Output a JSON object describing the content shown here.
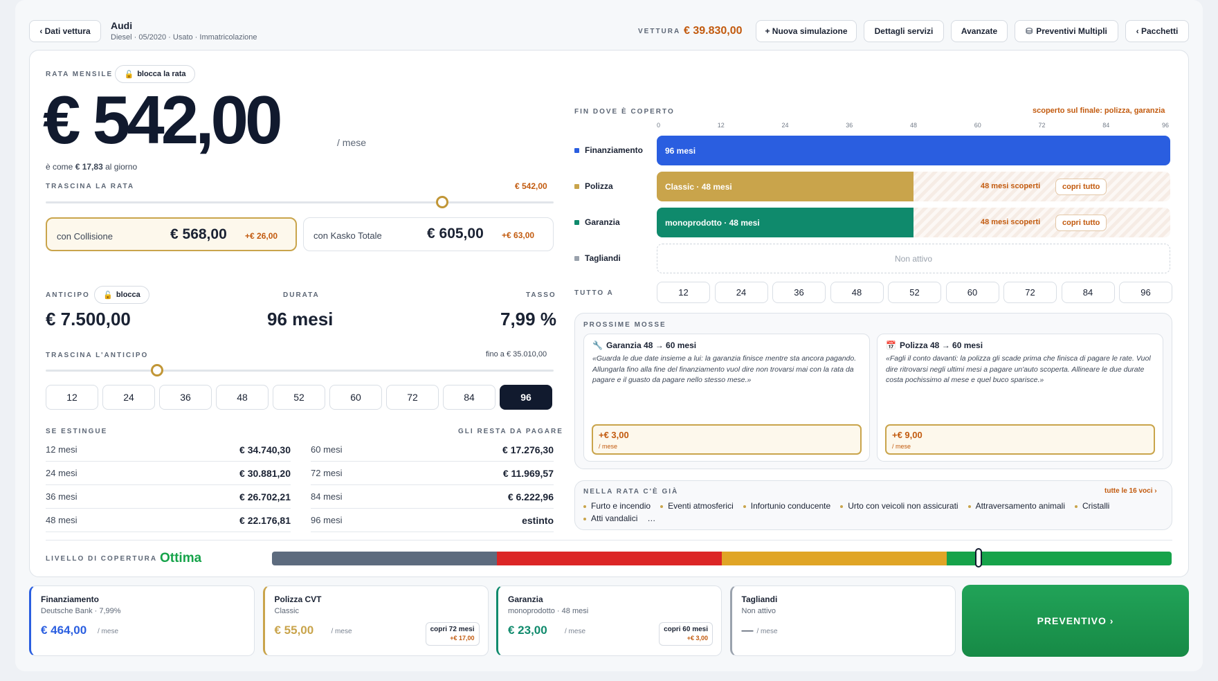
{
  "header": {
    "back_label": "‹ Dati vettura",
    "car_title": "Audi",
    "car_meta": "Diesel · 05/2020 · Usato · Immatricolazione",
    "vettura_label": "VETTURA",
    "vettura_price": "€ 39.830,00",
    "buttons": [
      "+ Nuova simulazione",
      "Dettagli servizi",
      "Avanzate",
      "Preventivi Multipli",
      "‹ Pacchetti"
    ]
  },
  "rata": {
    "label": "RATA MENSILE",
    "lock_label": "blocca la rata",
    "amount": "€ 542,00",
    "per_month": "/ mese",
    "per_day_prefix": "è come",
    "per_day_value": "€ 17,83",
    "per_day_suffix": "al giorno",
    "drag_label": "TRASCINA LA RATA",
    "drag_value": "€ 542,00",
    "slider_fraction": 0.78
  },
  "options": [
    {
      "label": "con Collisione",
      "price": "€ 568,00",
      "delta": "+€ 26,00"
    },
    {
      "label": "con Kasko Totale",
      "price": "€ 605,00",
      "delta": "+€ 63,00"
    }
  ],
  "anticipo": {
    "label": "ANTICIPO",
    "lock_label": "blocca",
    "value": "€ 7.500,00",
    "duration_label": "DURATA",
    "duration_value": "96 mesi",
    "rate_label": "TASSO",
    "rate_value": "7,99 %",
    "drag_label": "TRASCINA L'ANTICIPO",
    "max_label": "fino a € 35.010,00",
    "slider_fraction": 0.22
  },
  "months": [
    "12",
    "24",
    "36",
    "48",
    "52",
    "60",
    "72",
    "84",
    "96"
  ],
  "selected_month": "96",
  "payoff": {
    "left_header": "SE ESTINGUE",
    "right_header": "GLI RESTA DA PAGARE",
    "rows": [
      {
        "m1": "12 mesi",
        "v1": "€ 34.740,30",
        "m2": "60 mesi",
        "v2": "€ 17.276,30"
      },
      {
        "m1": "24 mesi",
        "v1": "€ 30.881,20",
        "m2": "72 mesi",
        "v2": "€ 11.969,57"
      },
      {
        "m1": "36 mesi",
        "v1": "€ 26.702,21",
        "m2": "84 mesi",
        "v2": "€ 6.222,96"
      },
      {
        "m1": "48 mesi",
        "v1": "€ 22.176,81",
        "m2": "96 mesi",
        "v2": "estinto"
      }
    ]
  },
  "coverage": {
    "label": "FIN DOVE È COPERTO",
    "warning": "scoperto sul finale: polizza, garanzia",
    "ticks": [
      "0",
      "12",
      "24",
      "36",
      "48",
      "60",
      "72",
      "84",
      "96"
    ],
    "max_months": 96,
    "rows": [
      {
        "name": "Finanziamento",
        "color": "#2a5ee0",
        "bar_label": "96 mesi",
        "months": 96,
        "uncovered": "",
        "action": ""
      },
      {
        "name": "Polizza",
        "color": "#c9a44b",
        "bar_label": "Classic · 48 mesi",
        "months": 48,
        "uncovered": "48 mesi scoperti",
        "action": "copri tutto"
      },
      {
        "name": "Garanzia",
        "color": "#0f8a6c",
        "bar_label": "monoprodotto · 48 mesi",
        "months": 48,
        "uncovered": "48 mesi scoperti",
        "action": "copri tutto"
      },
      {
        "name": "Tagliandi",
        "color": "#9aa2ad",
        "bar_label": "Non attivo",
        "months": 0,
        "uncovered": "",
        "action": ""
      }
    ],
    "tutto_label": "TUTTO A",
    "tutto_months": [
      "12",
      "24",
      "36",
      "48",
      "52",
      "60",
      "72",
      "84",
      "96"
    ]
  },
  "next_moves": {
    "label": "PROSSIME MOSSE",
    "cards": [
      {
        "icon": "wrench-icon",
        "title": "Garanzia 48 → 60 mesi",
        "body": "«Guarda le due date insieme a lui: la garanzia finisce mentre sta ancora pagando. Allungarla fino alla fine del finanziamento vuol dire non trovarsi mai con la rata da pagare e il guasto da pagare nello stesso mese.»",
        "price": "+€ 3,00",
        "per": "/ mese"
      },
      {
        "icon": "calendar-icon",
        "title": "Polizza 48 → 60 mesi",
        "body": "«Fagli il conto davanti: la polizza gli scade prima che finisca di pagare le rate. Vuol dire ritrovarsi negli ultimi mesi a pagare un'auto scoperta. Allineare le due durate costa pochissimo al mese e quel buco sparisce.»",
        "price": "+€ 9,00",
        "per": "/ mese"
      }
    ]
  },
  "included": {
    "label": "NELLA RATA C'È GIÀ",
    "all_link": "tutte le 16 voci ›",
    "items": [
      "Furto e incendio",
      "Eventi atmosferici",
      "Infortunio conducente",
      "Urto con veicoli non assicurati",
      "Attraversamento animali",
      "Cristalli",
      "Atti vandalici",
      "…"
    ]
  },
  "level": {
    "label": "LIVELLO DI COPERTURA",
    "value": "Ottima",
    "segments": [
      "#5d6b7e",
      "#dc2626",
      "#e0a526",
      "#16a34a"
    ],
    "marker_fraction": 0.785
  },
  "summary": [
    {
      "title": "Finanziamento",
      "sub": "Deutsche Bank · 7,99%",
      "price": "€ 464,00",
      "per": "/ mese",
      "color": "#2a5ee0",
      "mini1": "",
      "mini2": ""
    },
    {
      "title": "Polizza CVT",
      "sub": "Classic",
      "price": "€ 55,00",
      "per": "/ mese",
      "color": "#c9a44b",
      "mini1": "copri 72 mesi",
      "mini2": "+€ 17,00"
    },
    {
      "title": "Garanzia",
      "sub": "monoprodotto · 48 mesi",
      "price": "€ 23,00",
      "per": "/ mese",
      "color": "#0f8a6c",
      "mini1": "copri 60 mesi",
      "mini2": "+€ 3,00"
    },
    {
      "title": "Tagliandi",
      "sub": "Non attivo",
      "price": "—",
      "per": "/ mese",
      "color": "#9aa2ad",
      "mini1": "",
      "mini2": ""
    }
  ],
  "cta": "PREVENTIVO ›"
}
